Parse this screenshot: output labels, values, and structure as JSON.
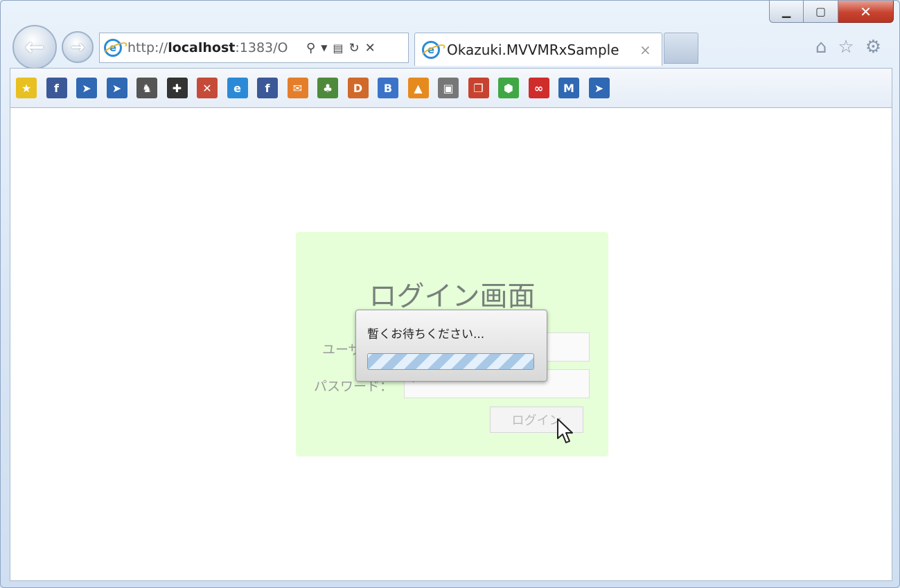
{
  "browser": {
    "url_prefix": "http://",
    "url_host": "localhost",
    "url_rest": ":1383/O",
    "tab_title": "Okazuki.MVVMRxSample",
    "tab_close": "×",
    "address_icons": [
      "search-icon",
      "dropdown-icon",
      "compat-icon",
      "refresh-icon",
      "stop-icon"
    ],
    "window_controls": [
      "minimize",
      "maximize",
      "close"
    ],
    "right_tools": [
      "home-icon",
      "favorites-star-icon",
      "settings-gear-icon"
    ]
  },
  "favorites": [
    {
      "name": "fav-star",
      "glyph": "★",
      "color": "#e8c021"
    },
    {
      "name": "fav-facebook",
      "glyph": "f",
      "color": "#3b5998"
    },
    {
      "name": "fav-arrow-1",
      "glyph": "➤",
      "color": "#2f68b3"
    },
    {
      "name": "fav-arrow-2",
      "glyph": "➤",
      "color": "#2f68b3"
    },
    {
      "name": "fav-person",
      "glyph": "♞",
      "color": "#555555"
    },
    {
      "name": "fav-gear",
      "glyph": "✚",
      "color": "#333333"
    },
    {
      "name": "fav-flower",
      "glyph": "✕",
      "color": "#c64a3a"
    },
    {
      "name": "fav-ie",
      "glyph": "e",
      "color": "#2b8ad8"
    },
    {
      "name": "fav-facebook-2",
      "glyph": "f",
      "color": "#3b5998"
    },
    {
      "name": "fav-mail",
      "glyph": "✉",
      "color": "#e57e2a"
    },
    {
      "name": "fav-evernote",
      "glyph": "♣",
      "color": "#4e8a3b"
    },
    {
      "name": "fav-d",
      "glyph": "D",
      "color": "#d0692a"
    },
    {
      "name": "fav-b",
      "glyph": "B",
      "color": "#3b73c9"
    },
    {
      "name": "fav-map",
      "glyph": "▲",
      "color": "#e68a1e"
    },
    {
      "name": "fav-tv",
      "glyph": "▣",
      "color": "#777777"
    },
    {
      "name": "fav-windows",
      "glyph": "❐",
      "color": "#c8432f"
    },
    {
      "name": "fav-hexagon",
      "glyph": "⬢",
      "color": "#3fa845"
    },
    {
      "name": "fav-link",
      "glyph": "∞",
      "color": "#d02c2c"
    },
    {
      "name": "fav-m",
      "glyph": "M",
      "color": "#2f68b3"
    },
    {
      "name": "fav-arrow-3",
      "glyph": "➤",
      "color": "#2f68b3"
    }
  ],
  "login": {
    "title": "ログイン画面",
    "user_label": "ユーザー名：",
    "password_label": "パスワード：",
    "password_value": "•",
    "button_label": "ログイン"
  },
  "modal": {
    "message": "暫くお待ちください...",
    "progress": 1.0
  },
  "colors": {
    "panel_bg": "#e6ffd9",
    "close_red": "#c8432f",
    "progress_blue": "#a8c8e6"
  }
}
